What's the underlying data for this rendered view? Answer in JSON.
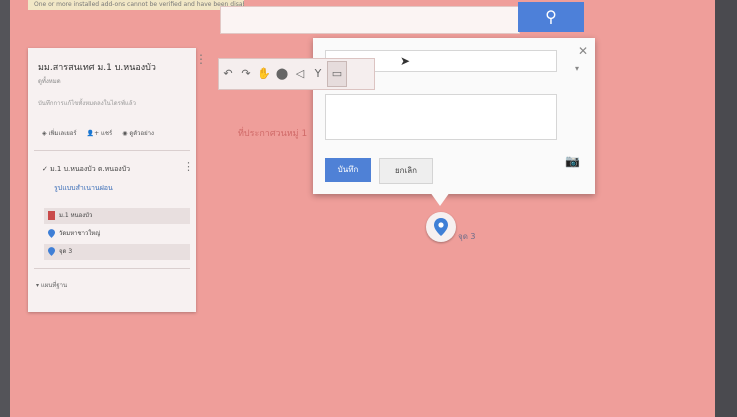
{
  "warning": {
    "text": "One or more installed add-ons cannot be verified and have been disabled."
  },
  "search": {
    "placeholder": "",
    "button_icon": "search-icon"
  },
  "toolbar": {
    "tools": [
      "undo",
      "redo",
      "hand",
      "marker",
      "line",
      "route",
      "ruler"
    ]
  },
  "sidebar": {
    "title": "มม.สารสนเทศ ม.1 บ.หนองบัว",
    "subtitle": "ดูทั้งหมด",
    "description": "บันทึกการแก้ไขทั้งหมดลงในไดรฟ์แล้ว",
    "actions": [
      "เพิ่มเลเยอร์",
      "แชร์",
      "ดูตัวอย่าง"
    ],
    "layer": {
      "title": "ม.1 บ.หนองบัว ต.หนองบัว",
      "style_label": "รูปแบบสำเนานฝอน",
      "items": [
        "ม.1 หนองบัว",
        "วัดมหาชาวใหญ่",
        "จุด 3"
      ]
    },
    "base_map": "แผนที่ฐาน"
  },
  "popup": {
    "save_label": "บันทึก",
    "cancel_label": "ยกเลิก"
  },
  "map": {
    "label": "ที่ประกาศวนหมู่ 1",
    "marker_label": "จุด 3"
  },
  "colors": {
    "accent": "#4f81d6",
    "map_bg": "#ef9e9a",
    "layer_icon": "#c94a4a"
  }
}
